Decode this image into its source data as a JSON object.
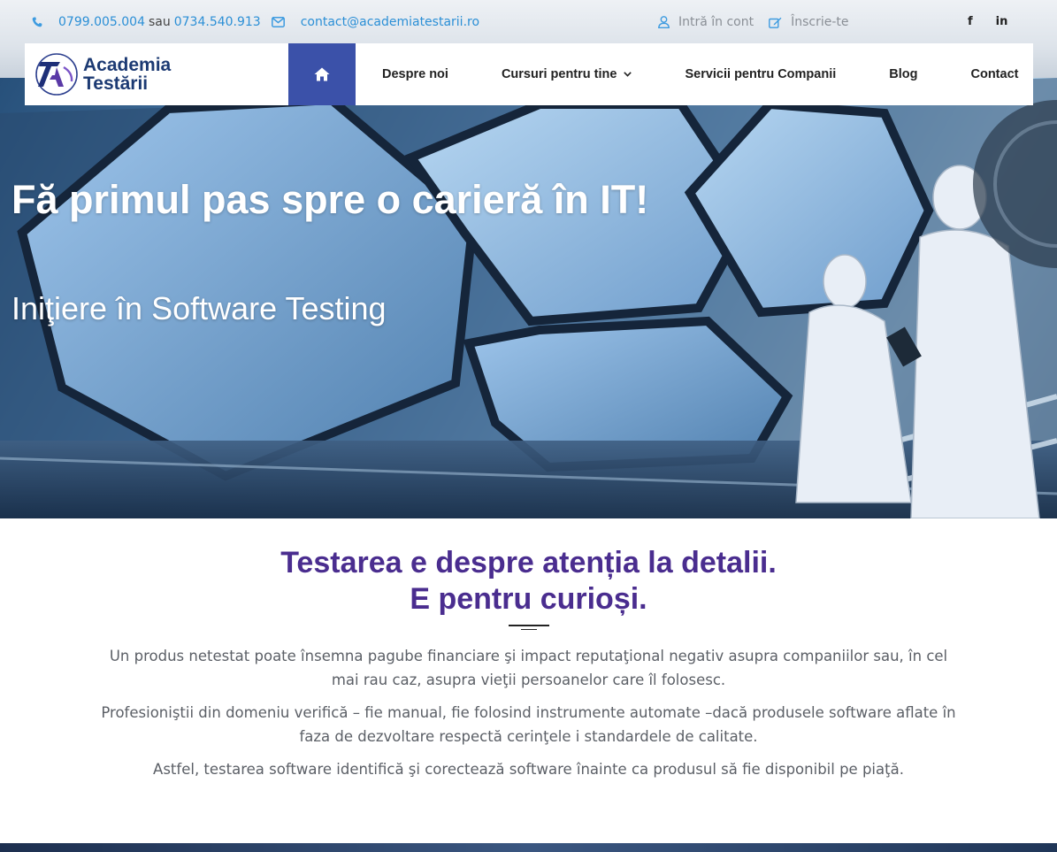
{
  "topbar": {
    "phone1": "0799.005.004",
    "phone_separator": "sau",
    "phone2": "0734.540.913",
    "email": "contact@academiatestarii.ro",
    "login_label": "Intră în cont",
    "signup_label": "Înscrie-te",
    "social": [
      "f",
      "in"
    ]
  },
  "nav": {
    "logo": {
      "line1": "Academia",
      "line2": "Testării"
    },
    "items": [
      {
        "label": "Despre noi"
      },
      {
        "label": "Cursuri pentru tine",
        "has_dropdown": true
      },
      {
        "label": "Servicii pentru Companii"
      },
      {
        "label": "Blog"
      },
      {
        "label": "Contact"
      }
    ]
  },
  "hero": {
    "title": "Fă primul pas spre o carieră în IT!",
    "subtitle": "Iniţiere în Software Testing"
  },
  "intro": {
    "heading_line1": "Testarea e despre atenția la detalii.",
    "heading_line2": "E pentru curioși.",
    "paragraph1": "Un produs netestat poate însemna pagube financiare şi impact reputaţional negativ asupra companiilor sau, în cel mai rau caz, asupra vieţii persoanelor care îl folosesc.",
    "paragraph2": "Profesioniştii din domeniu verifică – fie manual, fie folosind instrumente automate –dacă produsele software aflate în faza de dezvoltare respectă cerinţele i standardele de calitate.",
    "paragraph3": "Astfel, testarea software identifică şi corectează software înainte ca produsul să fie disponibil pe piaţă."
  },
  "colors": {
    "accent_blue": "#3b51a9",
    "link_blue": "#2b8fd6",
    "heading_purple": "#4a2d8f",
    "logo_navy": "#1c3a73"
  },
  "icons": [
    "phone-icon",
    "envelope-icon",
    "user-icon",
    "edit-icon",
    "facebook-icon",
    "linkedin-icon",
    "home-icon",
    "chevron-down-icon"
  ]
}
